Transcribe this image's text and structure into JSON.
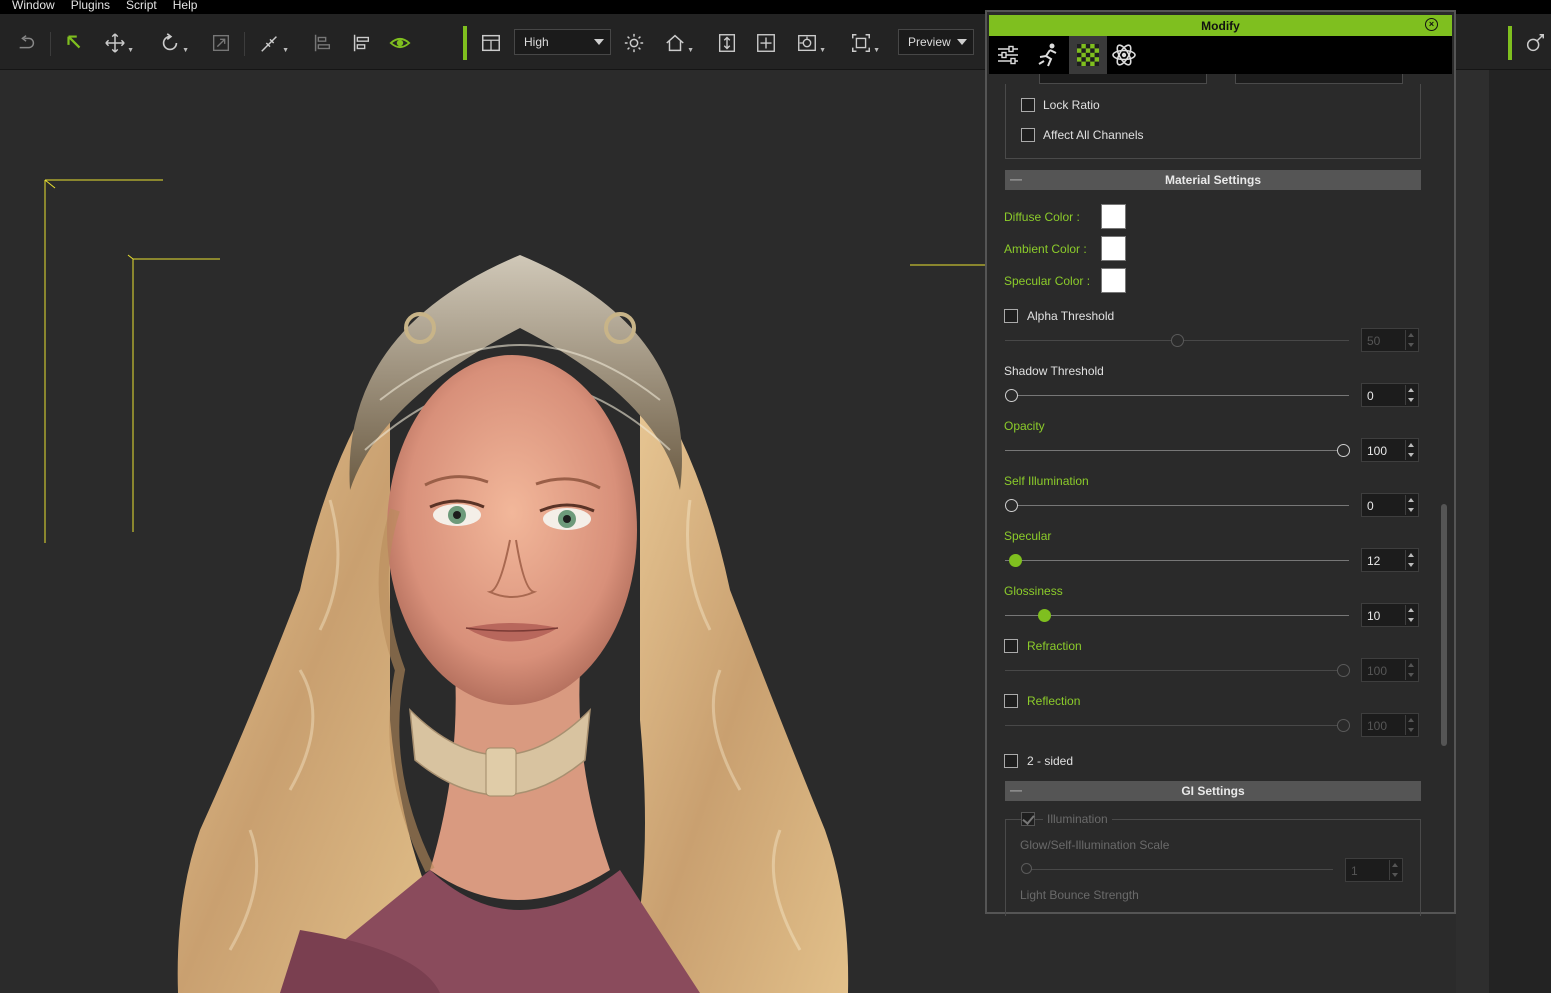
{
  "menu": [
    "Window",
    "Plugins",
    "Script",
    "Help"
  ],
  "toolbar": {
    "quality": "High",
    "render_mode": "Preview",
    "icons": [
      "redo-icon",
      "select-arrow-icon",
      "move-icon",
      "rotate-icon",
      "scale-icon",
      "snap-icon",
      "align-left-icon",
      "align-right-icon",
      "eye-icon",
      "window-icon",
      "sun-icon",
      "home-icon",
      "fit-icon",
      "center-icon",
      "camera-icon",
      "frame-icon",
      "reset-icon"
    ]
  },
  "panel": {
    "title": "Modify",
    "tabs": [
      "sliders-icon",
      "motion-icon",
      "material-checker-icon",
      "atom-icon"
    ],
    "top_options": [
      {
        "label": "Lock Ratio",
        "checked": false
      },
      {
        "label": "Affect All Channels",
        "checked": false
      }
    ],
    "material": {
      "header": "Material Settings",
      "diffuse": "Diffuse Color :",
      "ambient": "Ambient Color :",
      "specular_color": "Specular Color :",
      "alpha_threshold": {
        "label": "Alpha Threshold",
        "value": "50",
        "enabled": false
      },
      "shadow_threshold": {
        "label": "Shadow Threshold",
        "value": "0"
      },
      "opacity": {
        "label": "Opacity",
        "value": "100"
      },
      "self_illumination": {
        "label": "Self Illumination",
        "value": "0"
      },
      "specular": {
        "label": "Specular",
        "value": "12"
      },
      "glossiness": {
        "label": "Glossiness",
        "value": "10"
      },
      "refraction": {
        "label": "Refraction",
        "value": "100"
      },
      "reflection": {
        "label": "Reflection",
        "value": "100"
      },
      "two_sided": "2 - sided"
    },
    "gi": {
      "header": "GI Settings",
      "illumination": "Illumination",
      "glow_scale": {
        "label": "Glow/Self-Illumination Scale",
        "value": "1"
      },
      "light_bounce": "Light Bounce Strength"
    }
  },
  "colors": {
    "accent": "#7fbf1f",
    "viewport": "#2b2b2b"
  }
}
